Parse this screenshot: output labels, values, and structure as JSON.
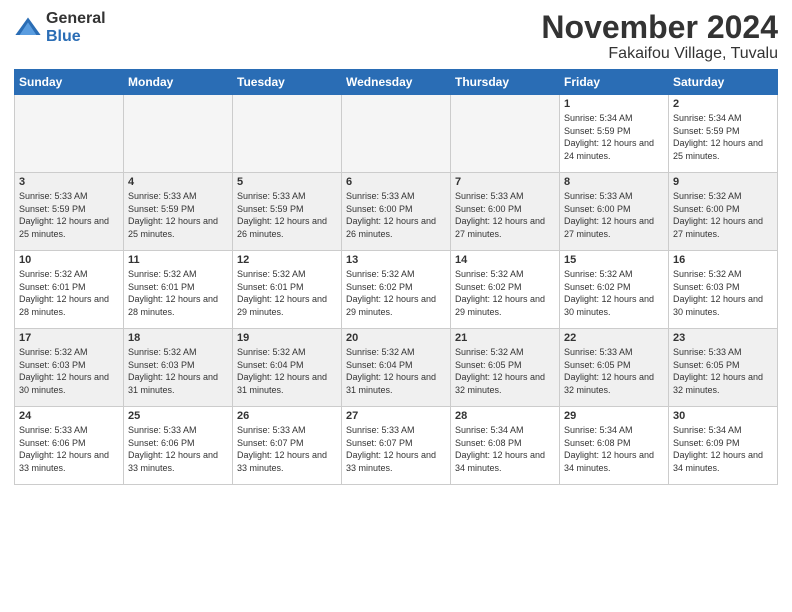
{
  "logo": {
    "general": "General",
    "blue": "Blue"
  },
  "title": "November 2024",
  "subtitle": "Fakaifou Village, Tuvalu",
  "weekdays": [
    "Sunday",
    "Monday",
    "Tuesday",
    "Wednesday",
    "Thursday",
    "Friday",
    "Saturday"
  ],
  "weeks": [
    [
      {
        "day": "",
        "info": "",
        "empty": true
      },
      {
        "day": "",
        "info": "",
        "empty": true
      },
      {
        "day": "",
        "info": "",
        "empty": true
      },
      {
        "day": "",
        "info": "",
        "empty": true
      },
      {
        "day": "",
        "info": "",
        "empty": true
      },
      {
        "day": "1",
        "info": "Sunrise: 5:34 AM\nSunset: 5:59 PM\nDaylight: 12 hours and 24 minutes."
      },
      {
        "day": "2",
        "info": "Sunrise: 5:34 AM\nSunset: 5:59 PM\nDaylight: 12 hours and 25 minutes."
      }
    ],
    [
      {
        "day": "3",
        "info": "Sunrise: 5:33 AM\nSunset: 5:59 PM\nDaylight: 12 hours and 25 minutes.",
        "shaded": true
      },
      {
        "day": "4",
        "info": "Sunrise: 5:33 AM\nSunset: 5:59 PM\nDaylight: 12 hours and 25 minutes.",
        "shaded": true
      },
      {
        "day": "5",
        "info": "Sunrise: 5:33 AM\nSunset: 5:59 PM\nDaylight: 12 hours and 26 minutes.",
        "shaded": true
      },
      {
        "day": "6",
        "info": "Sunrise: 5:33 AM\nSunset: 6:00 PM\nDaylight: 12 hours and 26 minutes.",
        "shaded": true
      },
      {
        "day": "7",
        "info": "Sunrise: 5:33 AM\nSunset: 6:00 PM\nDaylight: 12 hours and 27 minutes.",
        "shaded": true
      },
      {
        "day": "8",
        "info": "Sunrise: 5:33 AM\nSunset: 6:00 PM\nDaylight: 12 hours and 27 minutes.",
        "shaded": true
      },
      {
        "day": "9",
        "info": "Sunrise: 5:32 AM\nSunset: 6:00 PM\nDaylight: 12 hours and 27 minutes.",
        "shaded": true
      }
    ],
    [
      {
        "day": "10",
        "info": "Sunrise: 5:32 AM\nSunset: 6:01 PM\nDaylight: 12 hours and 28 minutes."
      },
      {
        "day": "11",
        "info": "Sunrise: 5:32 AM\nSunset: 6:01 PM\nDaylight: 12 hours and 28 minutes."
      },
      {
        "day": "12",
        "info": "Sunrise: 5:32 AM\nSunset: 6:01 PM\nDaylight: 12 hours and 29 minutes."
      },
      {
        "day": "13",
        "info": "Sunrise: 5:32 AM\nSunset: 6:02 PM\nDaylight: 12 hours and 29 minutes."
      },
      {
        "day": "14",
        "info": "Sunrise: 5:32 AM\nSunset: 6:02 PM\nDaylight: 12 hours and 29 minutes."
      },
      {
        "day": "15",
        "info": "Sunrise: 5:32 AM\nSunset: 6:02 PM\nDaylight: 12 hours and 30 minutes."
      },
      {
        "day": "16",
        "info": "Sunrise: 5:32 AM\nSunset: 6:03 PM\nDaylight: 12 hours and 30 minutes."
      }
    ],
    [
      {
        "day": "17",
        "info": "Sunrise: 5:32 AM\nSunset: 6:03 PM\nDaylight: 12 hours and 30 minutes.",
        "shaded": true
      },
      {
        "day": "18",
        "info": "Sunrise: 5:32 AM\nSunset: 6:03 PM\nDaylight: 12 hours and 31 minutes.",
        "shaded": true
      },
      {
        "day": "19",
        "info": "Sunrise: 5:32 AM\nSunset: 6:04 PM\nDaylight: 12 hours and 31 minutes.",
        "shaded": true
      },
      {
        "day": "20",
        "info": "Sunrise: 5:32 AM\nSunset: 6:04 PM\nDaylight: 12 hours and 31 minutes.",
        "shaded": true
      },
      {
        "day": "21",
        "info": "Sunrise: 5:32 AM\nSunset: 6:05 PM\nDaylight: 12 hours and 32 minutes.",
        "shaded": true
      },
      {
        "day": "22",
        "info": "Sunrise: 5:33 AM\nSunset: 6:05 PM\nDaylight: 12 hours and 32 minutes.",
        "shaded": true
      },
      {
        "day": "23",
        "info": "Sunrise: 5:33 AM\nSunset: 6:05 PM\nDaylight: 12 hours and 32 minutes.",
        "shaded": true
      }
    ],
    [
      {
        "day": "24",
        "info": "Sunrise: 5:33 AM\nSunset: 6:06 PM\nDaylight: 12 hours and 33 minutes."
      },
      {
        "day": "25",
        "info": "Sunrise: 5:33 AM\nSunset: 6:06 PM\nDaylight: 12 hours and 33 minutes."
      },
      {
        "day": "26",
        "info": "Sunrise: 5:33 AM\nSunset: 6:07 PM\nDaylight: 12 hours and 33 minutes."
      },
      {
        "day": "27",
        "info": "Sunrise: 5:33 AM\nSunset: 6:07 PM\nDaylight: 12 hours and 33 minutes."
      },
      {
        "day": "28",
        "info": "Sunrise: 5:34 AM\nSunset: 6:08 PM\nDaylight: 12 hours and 34 minutes."
      },
      {
        "day": "29",
        "info": "Sunrise: 5:34 AM\nSunset: 6:08 PM\nDaylight: 12 hours and 34 minutes."
      },
      {
        "day": "30",
        "info": "Sunrise: 5:34 AM\nSunset: 6:09 PM\nDaylight: 12 hours and 34 minutes."
      }
    ]
  ]
}
